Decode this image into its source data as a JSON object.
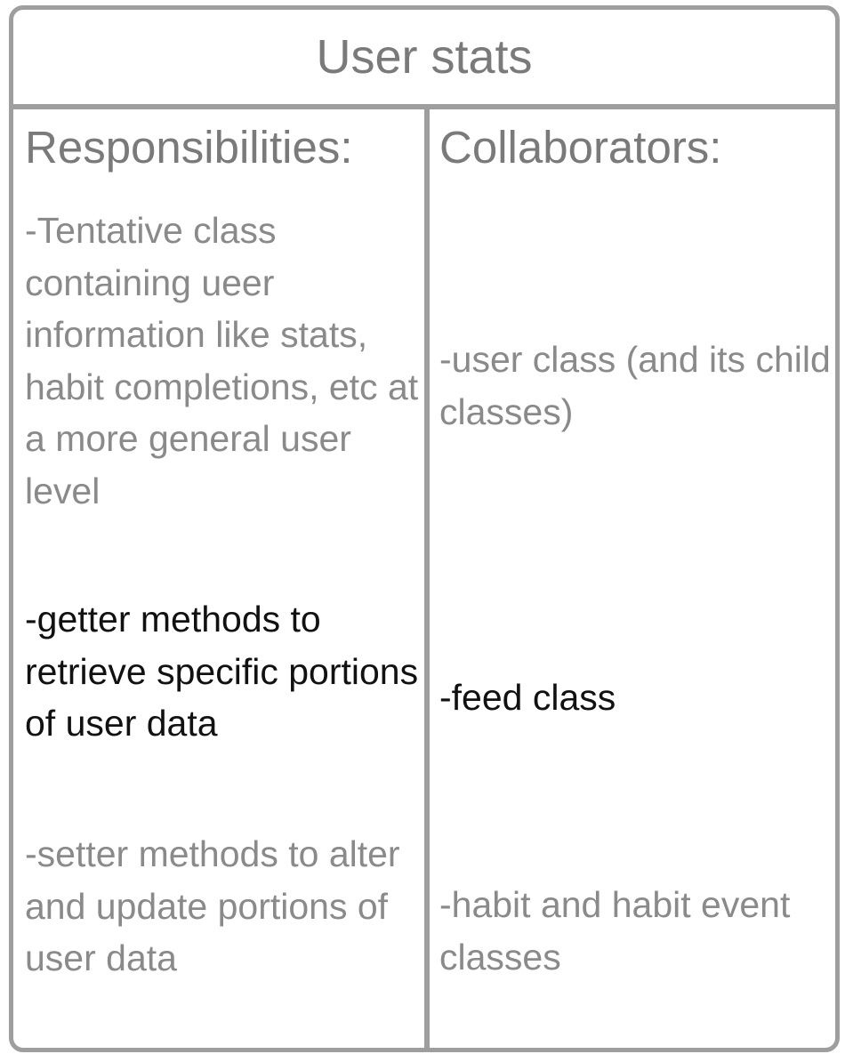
{
  "card": {
    "title": "User stats"
  },
  "responsibilities": {
    "header": "Responsibilities:",
    "items": [
      {
        "text": "-Tentative class containing ueer information like stats, habit completions, etc at a more general user level",
        "color": "#8a8a8a"
      },
      {
        "text": "-getter methods to retrieve specific portions of user data",
        "color": "#111111"
      },
      {
        "text": "-setter methods to alter and update portions of user data",
        "color": "#8a8a8a"
      }
    ]
  },
  "collaborators": {
    "header": "Collaborators:",
    "items": [
      {
        "text": "-user class (and its child classes)",
        "color": "#8a8a8a"
      },
      {
        "text": "-feed class",
        "color": "#111111"
      },
      {
        "text": "-habit and habit event classes",
        "color": "#8a8a8a"
      }
    ]
  },
  "colors": {
    "border": "#9e9e9e",
    "header_text": "#7a7a7a"
  }
}
